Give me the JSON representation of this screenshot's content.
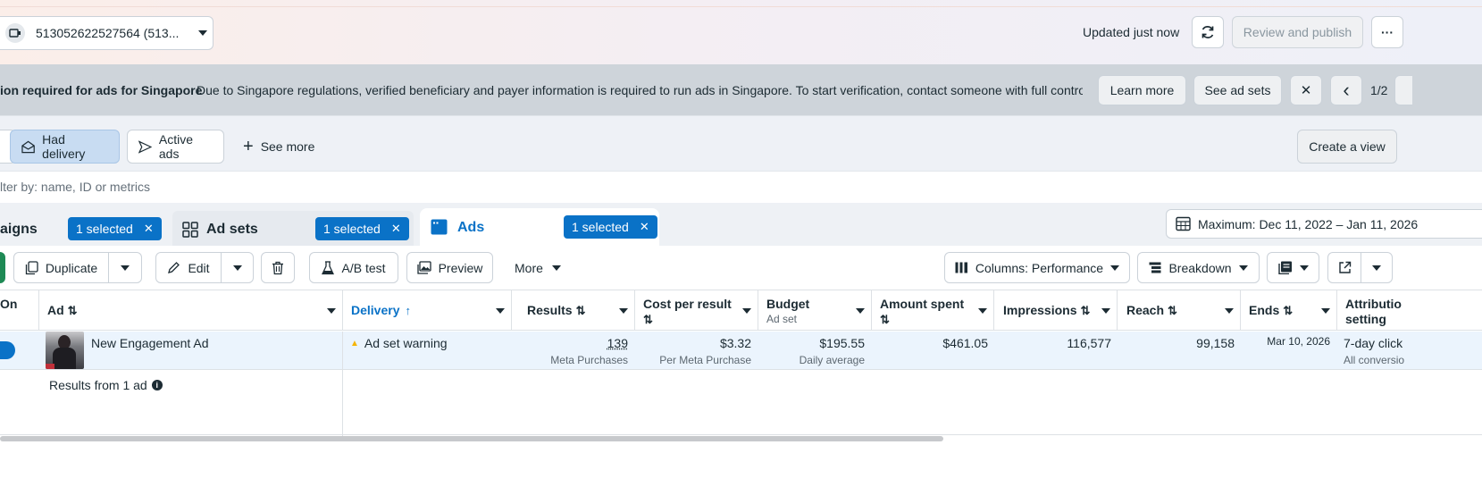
{
  "header": {
    "account_label": "513052622527564 (513...",
    "updated_text": "Updated just now",
    "refresh_icon": "refresh-icon",
    "review_publish_label": "Review and publish",
    "more_label": "···"
  },
  "banner": {
    "title": "ion required for ads for Singapore",
    "message": "Due to Singapore regulations, verified beneficiary and payer information is required to run ads in Singapore. To start verification, contact someone with full control ...",
    "learn_more": "Learn more",
    "see_ad_sets": "See ad sets",
    "close_glyph": "✕",
    "prev_glyph": "‹",
    "pager": "1/2"
  },
  "views": {
    "had_delivery": "Had delivery",
    "active_ads": "Active ads",
    "see_more": "See more",
    "plus_glyph": "+",
    "create_view": "Create a view"
  },
  "filter": {
    "placeholder": "lter by: name, ID or metrics"
  },
  "tabs": {
    "campaigns_label": "aigns",
    "campaigns_badge": "1 selected",
    "adsets_label": "Ad sets",
    "adsets_badge": "1 selected",
    "ads_label": "Ads",
    "ads_badge": "1 selected",
    "badge_close": "✕",
    "date_range": "Maximum: Dec 11, 2022 – Jan 11, 2026"
  },
  "toolbar": {
    "duplicate": "Duplicate",
    "edit": "Edit",
    "ab_test": "A/B test",
    "preview": "Preview",
    "more": "More",
    "columns": "Columns: Performance",
    "breakdown": "Breakdown"
  },
  "table": {
    "headers": {
      "on": "On",
      "ad": "Ad",
      "delivery": "Delivery",
      "results": "Results",
      "cost_per_result": "Cost per result",
      "budget": "Budget",
      "budget_sub": "Ad set",
      "amount_spent": "Amount spent",
      "impressions": "Impressions",
      "reach": "Reach",
      "ends": "Ends",
      "attribution": "Attributio",
      "attribution_2": "setting",
      "sort_glyph": "⇅",
      "sort_up_glyph": "↑"
    },
    "row": {
      "ad_name": "New Engagement Ad",
      "delivery": "Ad set warning",
      "warning_glyph": "▲",
      "results": "139",
      "results_sub": "Meta Purchases",
      "cost": "$3.32",
      "cost_sub": "Per Meta Purchase",
      "budget": "$195.55",
      "budget_sub": "Daily average",
      "amount_spent": "$461.05",
      "impressions": "116,577",
      "reach": "99,158",
      "ends": "Mar 10, 2026",
      "attribution": "7-day click",
      "attribution_sub": "All conversio"
    },
    "footer": "Results from 1 ad",
    "info_glyph": "i"
  },
  "colors": {
    "accent": "#0a72c7",
    "banner_bg": "#ced4da",
    "selected_row": "#ebf4fd",
    "warning": "#f5b400"
  }
}
